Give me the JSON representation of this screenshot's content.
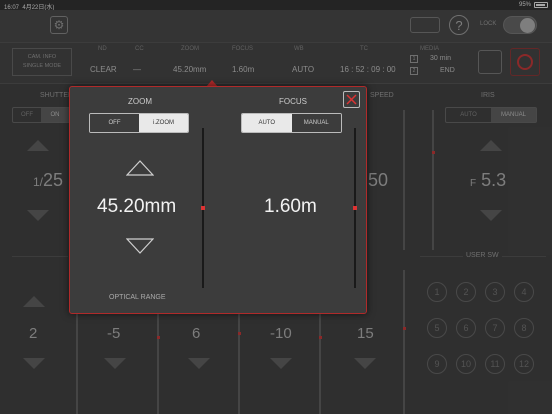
{
  "status_bar": {
    "time": "16:07",
    "date": "4月22日(水)",
    "battery": "95%"
  },
  "toolbar": {
    "gear_icon": "gear-icon",
    "top_button": "",
    "help": "?",
    "lock_label": "LOCK"
  },
  "info_bar": {
    "cam_info": "CAM. INFO",
    "mode": "SINGLE MODE",
    "nd_head": "ND",
    "nd_val": "CLEAR",
    "cc_head": "CC",
    "cc_val": "—",
    "zoom_head": "ZOOM",
    "zoom_val": "45.20mm",
    "focus_head": "FOCUS",
    "focus_val": "1.60m",
    "white_head": "WB",
    "white_val": "AUTO",
    "tc_head": "TC",
    "tc_val": "16 : 52 : 09 : 00",
    "media_head": "MEDIA",
    "media_remain": "30 min",
    "media_end": "END",
    "media_1": "1",
    "media_2": "2"
  },
  "background": {
    "shutter_label": "SHUTTER",
    "shutter_off": "OFF",
    "shutter_on": "ON",
    "shutter_prefix": "1/",
    "shutter_val": "25",
    "speed_label": "SPEED",
    "speed_val": "50",
    "iris_label": "IRIS",
    "iris_auto": "AUTO",
    "iris_manual": "MANUAL",
    "iris_prefix": "F",
    "iris_val": "5.3",
    "user_sw": "USER SW",
    "lower_vals": [
      "2",
      "-5",
      "6",
      "-10",
      "15"
    ],
    "circles": [
      "1",
      "2",
      "3",
      "4",
      "5",
      "6",
      "7",
      "8",
      "9",
      "10",
      "11",
      "12"
    ]
  },
  "popup": {
    "zoom_title": "ZOOM",
    "zoom_off": "OFF",
    "zoom_izoom": "i.ZOOM",
    "zoom_value": "45.20mm",
    "optical_range": "OPTICAL RANGE",
    "focus_title": "FOCUS",
    "focus_auto": "AUTO",
    "focus_manual": "MANUAL",
    "focus_value": "1.60m"
  },
  "colors": {
    "accent_red": "#b02a2a",
    "selected_bg": "#e9e9e9"
  }
}
